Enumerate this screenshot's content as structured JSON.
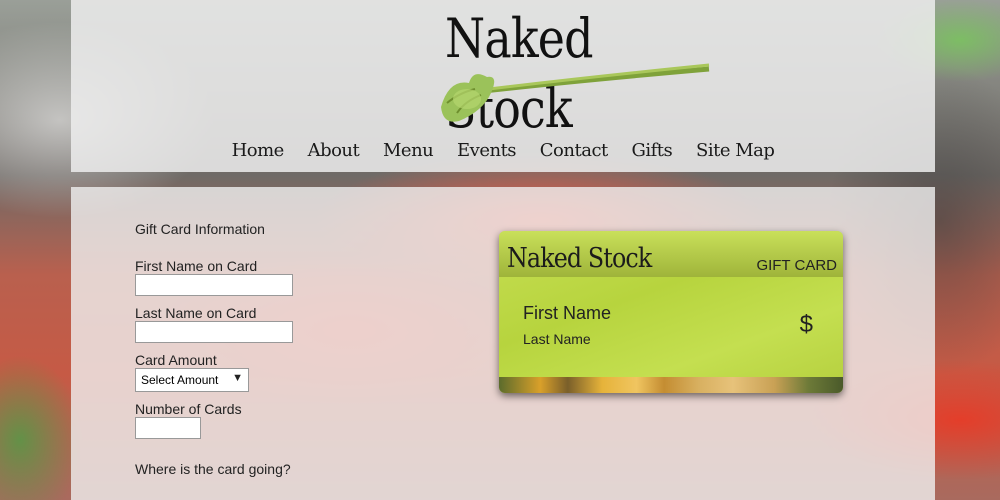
{
  "site": {
    "logo_text": "Naked Stock",
    "nav": [
      "Home",
      "About",
      "Menu",
      "Events",
      "Contact",
      "Gifts",
      "Site Map"
    ]
  },
  "form": {
    "section_title": "Gift Card Information",
    "first_name_label": "First Name on Card",
    "first_name_value": "",
    "last_name_label": "Last Name on Card",
    "last_name_value": "",
    "amount_label": "Card Amount",
    "amount_selected": "Select Amount",
    "count_label": "Number of Cards",
    "count_value": "",
    "destination_label": "Where is the card going?"
  },
  "card_preview": {
    "brand": "Naked Stock",
    "tag": "GIFT CARD",
    "first_name": "First Name",
    "last_name": "Last Name",
    "currency_symbol": "$"
  },
  "colors": {
    "card_green": "#c1da4c",
    "panel_overlay": "#f0f0f0"
  }
}
